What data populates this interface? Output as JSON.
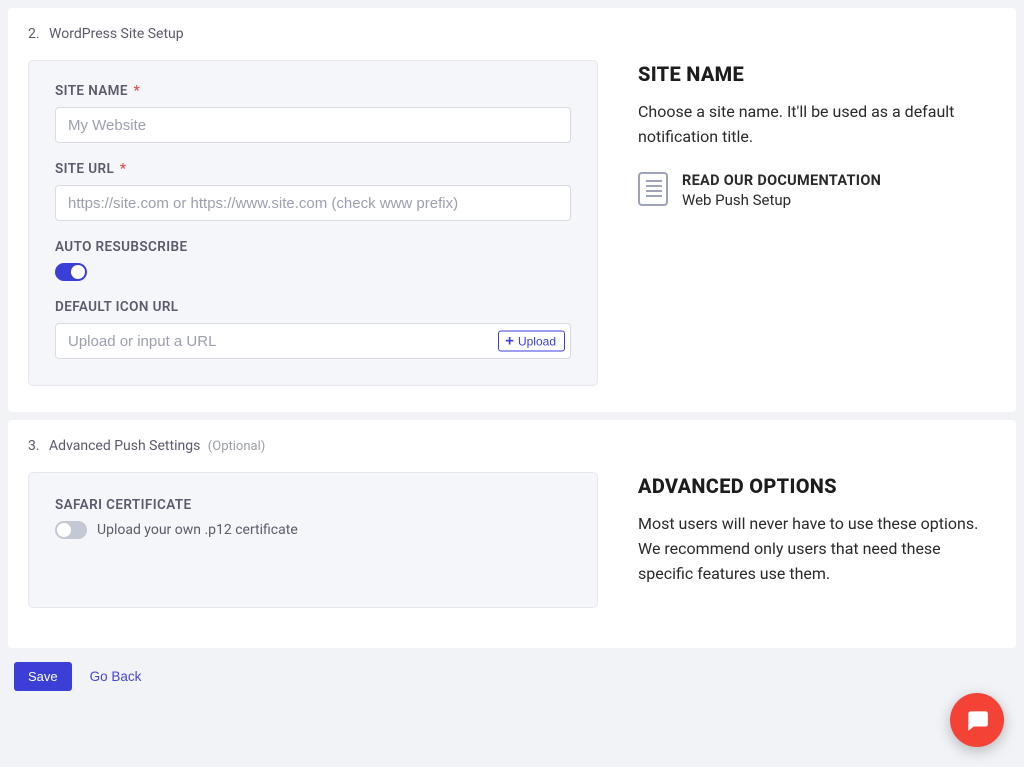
{
  "section2": {
    "number": "2.",
    "title": "WordPress Site Setup",
    "fields": {
      "site_name_label": "SITE NAME",
      "site_name_placeholder": "My Website",
      "site_url_label": "SITE URL",
      "site_url_placeholder": "https://site.com or https://www.site.com (check www prefix)",
      "auto_resubscribe_label": "AUTO RESUBSCRIBE",
      "default_icon_label": "DEFAULT ICON URL",
      "default_icon_placeholder": "Upload or input a URL",
      "upload_button": "Upload"
    },
    "right": {
      "heading": "SITE NAME",
      "description": "Choose a site name. It'll be used as a default notification title.",
      "doc_title": "READ OUR DOCUMENTATION",
      "doc_sub": "Web Push Setup"
    }
  },
  "section3": {
    "number": "3.",
    "title": "Advanced Push Settings",
    "optional": "(Optional)",
    "fields": {
      "safari_cert_label": "SAFARI CERTIFICATE",
      "safari_cert_sub": "Upload your own .p12 certificate"
    },
    "right": {
      "heading": "ADVANCED OPTIONS",
      "description": "Most users will never have to use these options. We recommend only users that need these specific features use them."
    }
  },
  "footer": {
    "save": "Save",
    "go_back": "Go Back"
  }
}
